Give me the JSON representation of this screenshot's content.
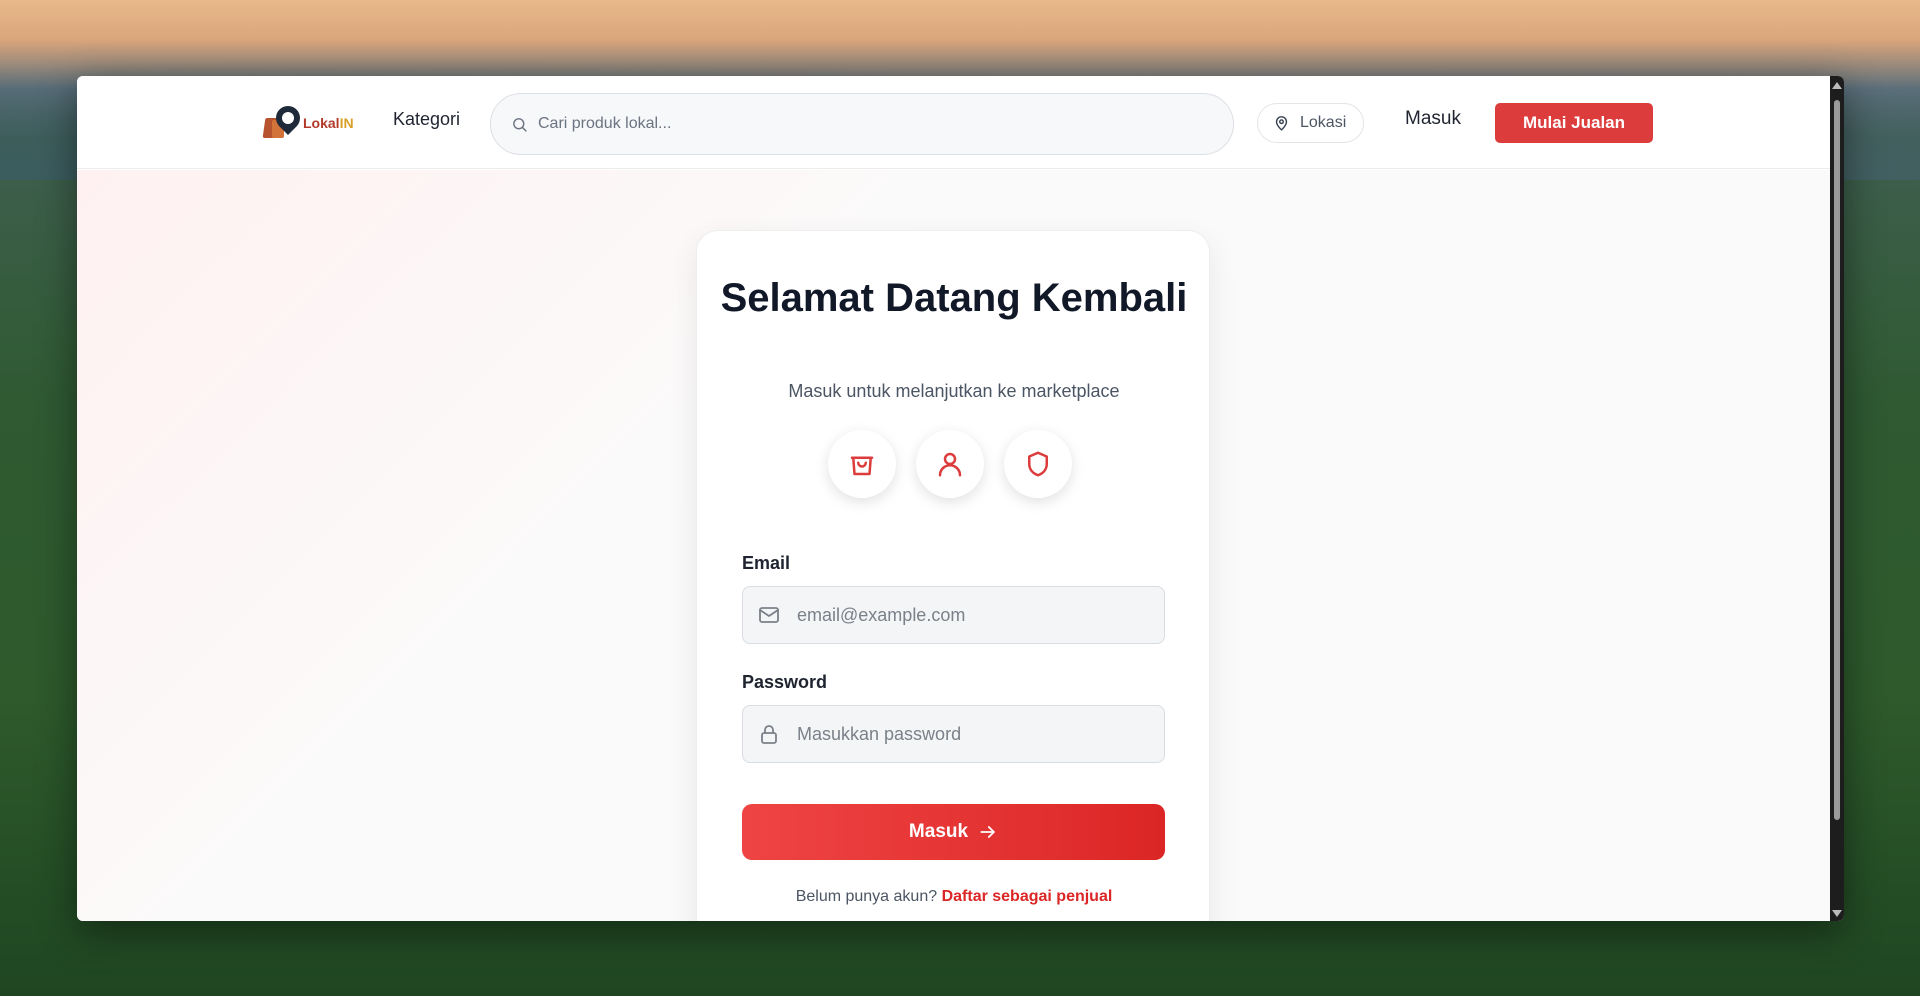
{
  "navbar": {
    "logo_text_a": "Lokal",
    "logo_text_b": "IN",
    "kategori_label": "Kategori",
    "search_placeholder": "Cari produk lokal...",
    "lokasi_label": "Lokasi",
    "masuk_label": "Masuk",
    "jualan_label": "Mulai Jualan"
  },
  "login": {
    "title": "Selamat Datang Kembali",
    "subtitle": "Masuk untuk melanjutkan ke marketplace",
    "email_label": "Email",
    "email_placeholder": "email@example.com",
    "password_label": "Password",
    "password_placeholder": "Masukkan password",
    "submit_label": "Masuk",
    "register_prompt": "Belum punya akun?",
    "register_link": "Daftar sebagai penjual"
  },
  "feature_icons": [
    "shopping-bag-icon",
    "user-icon",
    "shield-icon"
  ],
  "colors": {
    "accent": "#dc3c3c",
    "text_dark": "#111827"
  }
}
